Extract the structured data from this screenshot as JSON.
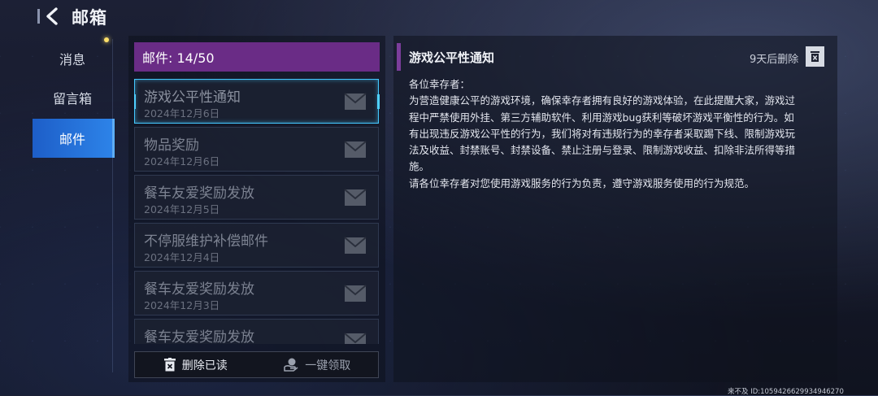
{
  "header": {
    "title": "邮箱"
  },
  "nav": {
    "items": [
      {
        "label": "消息",
        "active": false
      },
      {
        "label": "留言箱",
        "active": false
      },
      {
        "label": "邮件",
        "active": true
      }
    ]
  },
  "mailbox": {
    "count_label": "邮件: 14/50",
    "mails": [
      {
        "subject": "游戏公平性通知",
        "date": "2024年12月6日",
        "selected": true
      },
      {
        "subject": "物品奖励",
        "date": "2024年12月6日",
        "selected": false
      },
      {
        "subject": "餐车友爱奖励发放",
        "date": "2024年12月5日",
        "selected": false
      },
      {
        "subject": "不停服维护补偿邮件",
        "date": "2024年12月4日",
        "selected": false
      },
      {
        "subject": "餐车友爱奖励发放",
        "date": "2024年12月3日",
        "selected": false
      },
      {
        "subject": "餐车友爱奖励发放",
        "date": "",
        "selected": false
      }
    ],
    "delete_read_label": "删除已读",
    "claim_all_label": "一键领取"
  },
  "detail": {
    "title": "游戏公平性通知",
    "expire_label": "9天后删除",
    "greeting": "各位幸存者：",
    "lines": [
      "为营造健康公平的游戏环境，确保幸存者拥有良好的游戏体验，在此提醒大家，游戏过",
      "程中严禁使用外挂、第三方辅助软件、利用游戏bug获利等破坏游戏平衡性的行为。如",
      "有出现违反游戏公平性的行为，我们将对有违规行为的幸存者采取踢下线、限制游戏玩",
      "法及收益、封禁账号、封禁设备、禁止注册与登录、限制游戏收益、扣除非法所得等措",
      "施。",
      "请各位幸存者对您使用游戏服务的行为负责，遵守游戏服务使用的行为规范。"
    ]
  },
  "footer": {
    "id_text": "来不及 ID:1059426629934946270"
  },
  "colors": {
    "accent_blue": "#2d83e8",
    "accent_purple": "#6a2c86",
    "selected_border": "#44c8ff"
  },
  "icons": [
    "back-arrow-icon",
    "envelope-icon",
    "trash-icon",
    "claim-hand-icon"
  ]
}
